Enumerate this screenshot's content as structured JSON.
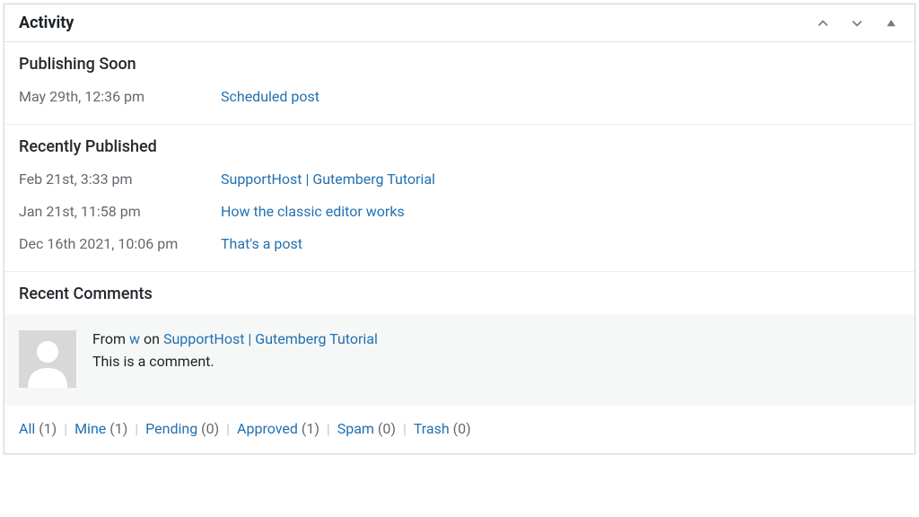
{
  "widget": {
    "title": "Activity"
  },
  "publishing_soon": {
    "heading": "Publishing Soon",
    "items": [
      {
        "date": "May 29th, 12:36 pm",
        "title": "Scheduled post"
      }
    ]
  },
  "recently_published": {
    "heading": "Recently Published",
    "items": [
      {
        "date": "Feb 21st, 3:33 pm",
        "title": "SupportHost | Gutemberg Tutorial"
      },
      {
        "date": "Jan 21st, 11:58 pm",
        "title": "How the classic editor works"
      },
      {
        "date": "Dec 16th 2021, 10:06 pm",
        "title": "That's a post"
      }
    ]
  },
  "recent_comments": {
    "heading": "Recent Comments",
    "items": [
      {
        "from_prefix": "From ",
        "author": "w",
        "on_text": " on ",
        "post": "SupportHost | Gutemberg Tutorial",
        "body": "This is a comment."
      }
    ]
  },
  "filters": {
    "items": [
      {
        "label": "All",
        "count": "(1)"
      },
      {
        "label": "Mine",
        "count": "(1)"
      },
      {
        "label": "Pending",
        "count": "(0)"
      },
      {
        "label": "Approved",
        "count": "(1)"
      },
      {
        "label": "Spam",
        "count": "(0)"
      },
      {
        "label": "Trash",
        "count": "(0)"
      }
    ],
    "separator": " | "
  }
}
